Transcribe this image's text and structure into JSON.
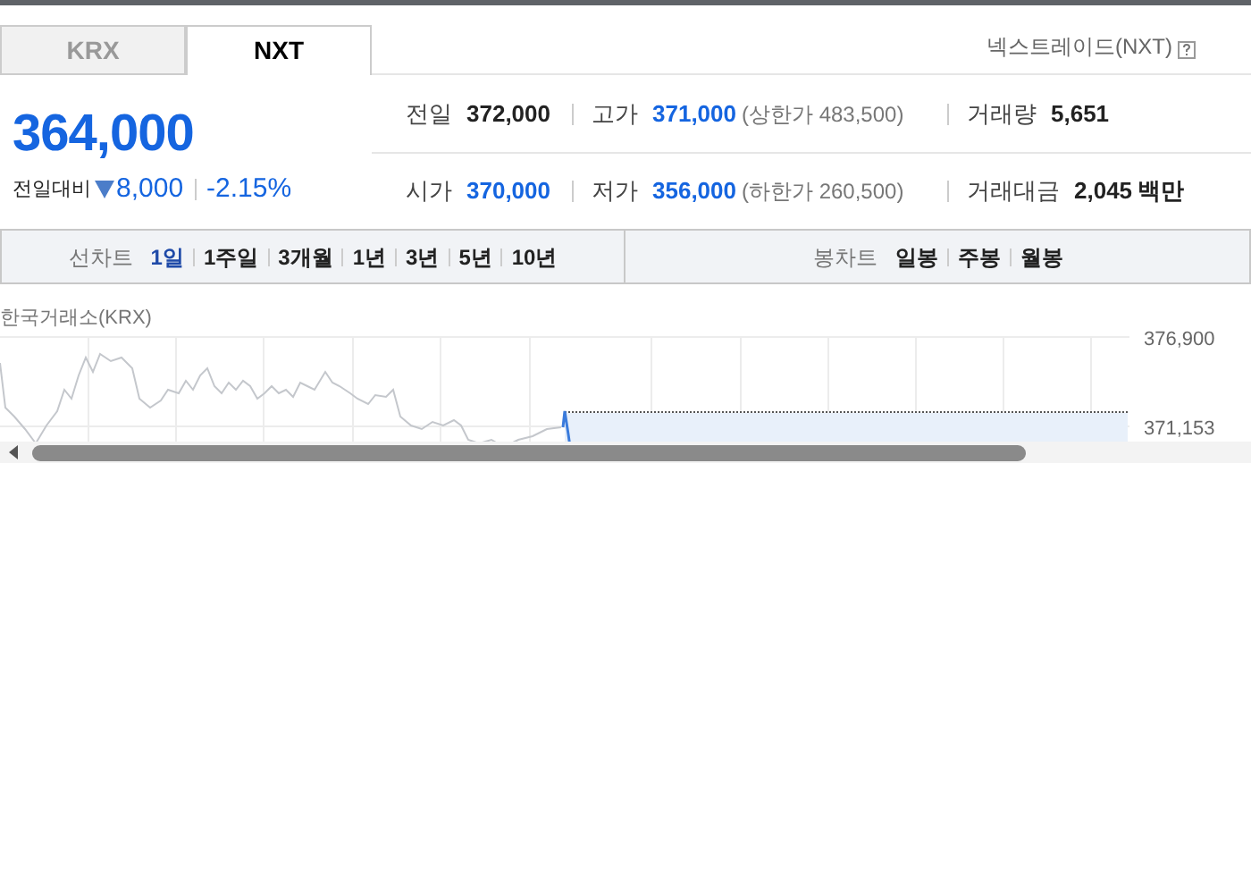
{
  "market_tabs": [
    {
      "label": "KRX",
      "selected": false
    },
    {
      "label": "NXT",
      "selected": true
    }
  ],
  "exchange_label": "넥스트레이드(NXT)",
  "price": {
    "current": "364,000",
    "change_label": "전일대비",
    "falling": true,
    "change": "8,000",
    "change_rate": "-2.15%"
  },
  "stats": [
    {
      "label": "전일",
      "value": "372,000",
      "kind": "plain"
    },
    {
      "label": "고가",
      "value": "371,000",
      "kind": "limit",
      "limit": "(상한가 483,500)"
    },
    {
      "label": "거래량",
      "value": "5,651",
      "kind": "plain"
    },
    {
      "label": "시가",
      "value": "370,000",
      "kind": "blue"
    },
    {
      "label": "저가",
      "value": "356,000",
      "kind": "limit",
      "limit": "(하한가 260,500)"
    },
    {
      "label": "거래대금",
      "value": "2,045",
      "kind": "unit",
      "unit": "백만"
    }
  ],
  "line_chart": {
    "label": "선차트",
    "periods": [
      {
        "label": "1일",
        "selected": true
      },
      {
        "label": "1주일",
        "selected": false
      },
      {
        "label": "3개월",
        "selected": false
      },
      {
        "label": "1년",
        "selected": false
      },
      {
        "label": "3년",
        "selected": false
      },
      {
        "label": "5년",
        "selected": false
      },
      {
        "label": "10년",
        "selected": false
      }
    ]
  },
  "candle_chart": {
    "label": "봉차트",
    "periods": [
      {
        "label": "일봉",
        "selected": false
      },
      {
        "label": "주봉",
        "selected": false
      },
      {
        "label": "월봉",
        "selected": false
      }
    ]
  },
  "chart_source": "한국거래소(KRX)",
  "chart_labels": [
    "376,900",
    "371,153"
  ]
}
